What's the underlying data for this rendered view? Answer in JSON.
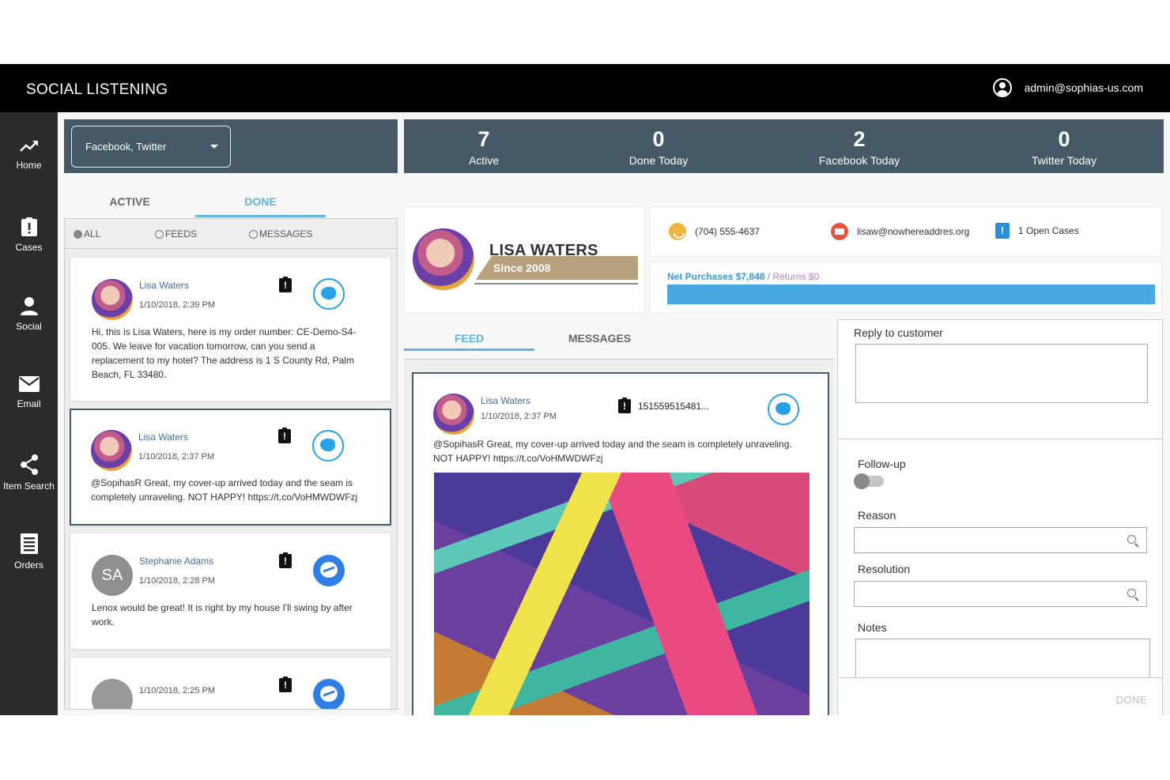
{
  "header": {
    "title": "SOCIAL LISTENING",
    "user_email": "admin@sophias-us.com",
    "user_icon": "user-circle-icon"
  },
  "sidebar": {
    "items": [
      {
        "label": "Home",
        "icon": "trending-up-icon"
      },
      {
        "label": "Cases",
        "icon": "clipboard-alert-icon"
      },
      {
        "label": "Social",
        "icon": "person-icon"
      },
      {
        "label": "Email",
        "icon": "envelope-icon"
      },
      {
        "label": "Item Search",
        "icon": "share-icon"
      },
      {
        "label": "Orders",
        "icon": "list-icon"
      }
    ]
  },
  "filter": {
    "channel_select": "Facebook, Twitter"
  },
  "left_tabs": {
    "active": "ACTIVE",
    "done": "DONE",
    "selected": "DONE"
  },
  "radio_filter": {
    "all": "ALL",
    "feeds": "FEEDS",
    "messages": "MESSAGES",
    "selected": "ALL"
  },
  "posts": [
    {
      "name": "Lisa Waters",
      "time": "1/10/2018, 2:39 PM",
      "text": "Hi, this is Lisa Waters, here is my order number: CE-Demo-S4-005. We leave for vacation tomorrow, can you send a replacement to my hotel? The address is 1 S County Rd, Palm Beach, FL 33480.",
      "channel": "twitter"
    },
    {
      "name": "Lisa Waters",
      "time": "1/10/2018, 2:37 PM",
      "text": "@SopihasR Great, my cover-up arrived today and the seam is completely unraveling. NOT HAPPY! https://t.co/VoHMWDWFzj",
      "channel": "twitter"
    },
    {
      "name": "Stephanie Adams",
      "initials": "SA",
      "time": "1/10/2018, 2:28 PM",
      "text": "Lenox would be great! It is right by my house I'll swing by after work.",
      "channel": "messenger"
    },
    {
      "name": "",
      "time": "1/10/2018, 2:25 PM",
      "text": "",
      "channel": "messenger"
    }
  ],
  "stats": [
    {
      "value": "7",
      "label": "Active"
    },
    {
      "value": "0",
      "label": "Done Today"
    },
    {
      "value": "2",
      "label": "Facebook Today"
    },
    {
      "value": "0",
      "label": "Twitter Today"
    }
  ],
  "customer": {
    "name": "LISA WATERS",
    "since": "Since 2008",
    "phone": "(704) 555-4637",
    "email": "lisaw@nowhereaddres.org",
    "open_cases": "1 Open Cases",
    "net_purchases": "Net Purchases $7,848",
    "separator": "/",
    "returns": "Returns $0",
    "purchase_fraction": 1.0
  },
  "mid_tabs": {
    "feed": "FEED",
    "messages": "MESSAGES",
    "selected": "FEED"
  },
  "feed_post": {
    "name": "Lisa Waters",
    "time": "1/10/2018, 2:37 PM",
    "case_id": "151559515481...",
    "text": "@SopihasR Great, my cover-up arrived today and the seam is completely unraveling. NOT HAPPY! https://t.co/VoHMWDWFzj",
    "channel": "twitter"
  },
  "reply_panel": {
    "reply_label": "Reply to customer",
    "followup_label": "Follow-up",
    "followup_on": false,
    "reason_label": "Reason",
    "resolution_label": "Resolution",
    "notes_label": "Notes",
    "done_label": "DONE"
  }
}
